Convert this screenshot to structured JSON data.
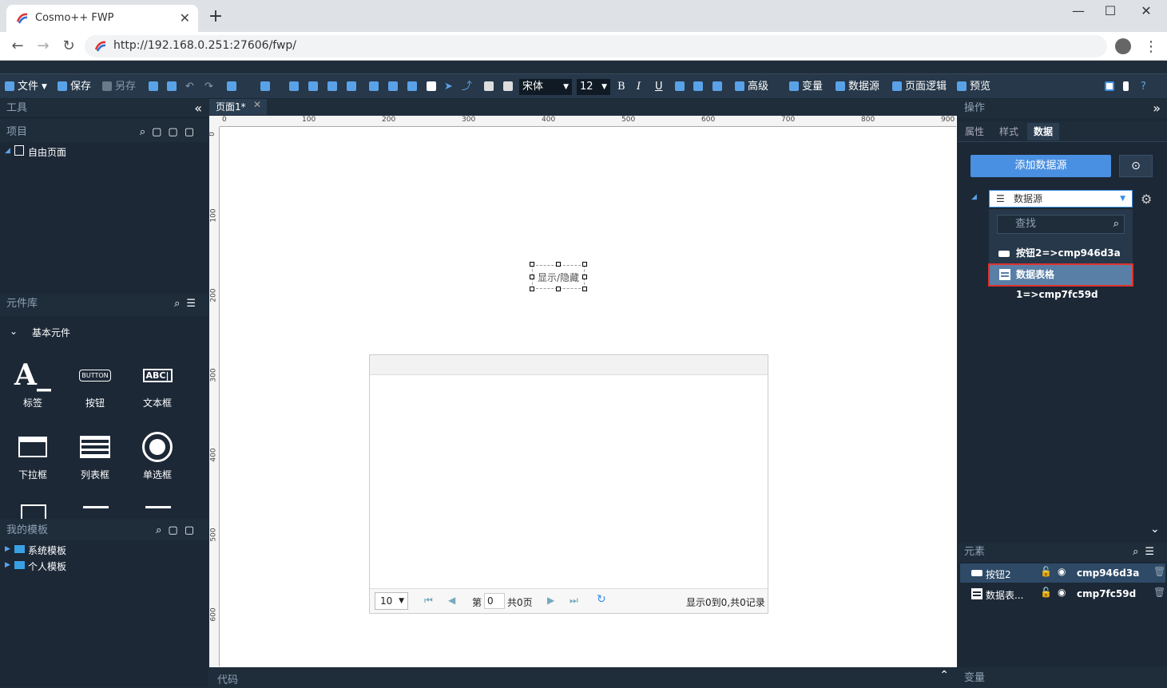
{
  "browser": {
    "tab_title": "Cosmo++ FWP",
    "url": "http://192.168.0.251:27606/fwp/"
  },
  "toolbar": {
    "file": "文件",
    "save": "保存",
    "save_as": "另存",
    "font": "宋体",
    "size": "12",
    "advanced": "高级",
    "variable": "变量",
    "datasource": "数据源",
    "page_logic": "页面逻辑",
    "preview": "预览"
  },
  "left": {
    "tools_title": "工具",
    "project_title": "项目",
    "project_root": "自由页面",
    "library_title": "元件库",
    "basic_group": "基本元件",
    "components": [
      {
        "icon": "label-icon",
        "label": "标签"
      },
      {
        "icon": "button-icon",
        "label": "按钮"
      },
      {
        "icon": "textbox-icon",
        "label": "文本框"
      },
      {
        "icon": "dropdown-icon",
        "label": "下拉框"
      },
      {
        "icon": "listbox-icon",
        "label": "列表框"
      },
      {
        "icon": "radio-icon",
        "label": "单选框"
      }
    ],
    "templates_title": "我的模板",
    "templates": [
      "系统模板",
      "个人模板"
    ]
  },
  "canvas": {
    "doc_tab": "页面1*",
    "ruler_h": [
      "0",
      "100",
      "200",
      "300",
      "400",
      "500",
      "600",
      "700",
      "800",
      "900"
    ],
    "ruler_v": [
      "0",
      "100",
      "200",
      "300",
      "400",
      "500",
      "600"
    ],
    "widget_text": "显示/隐藏",
    "grid_pager": {
      "page_size": "10",
      "page_prefix": "第",
      "page_value": "0",
      "page_total": "共0页",
      "summary": "显示0到0,共0记录"
    }
  },
  "bottom": {
    "code_title": "代码",
    "variable_title": "变量"
  },
  "right": {
    "ops_title": "操作",
    "tabs": [
      "属性",
      "样式",
      "数据"
    ],
    "add_datasource": "添加数据源",
    "datasource_select": "数据源",
    "search_placeholder": "查找",
    "ds_items": [
      "按钮2=>cmp946d3a",
      "数据表格1=>cmp7fc59d"
    ],
    "elements_title": "元素",
    "elements": [
      {
        "name": "按钮2",
        "id": "cmp946d3a"
      },
      {
        "name": "数据表...",
        "id": "cmp7fc59d"
      }
    ]
  },
  "colors": {
    "accent": "#4a90e2",
    "highlight_border": "#e0322e",
    "panel": "#1c2836"
  }
}
